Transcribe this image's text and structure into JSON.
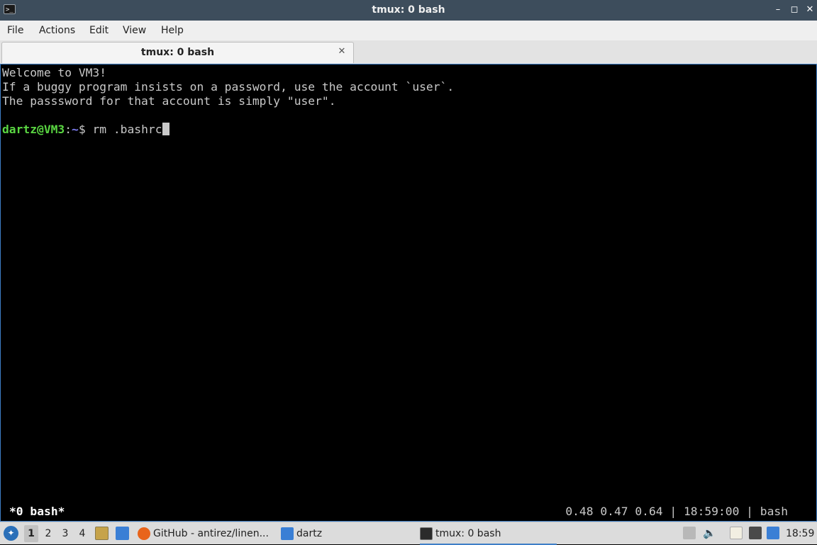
{
  "window": {
    "title": "tmux: 0 bash",
    "controls": {
      "minimize": "–",
      "maximize": "◻",
      "close": "✕"
    }
  },
  "menu": {
    "items": [
      "File",
      "Actions",
      "Edit",
      "View",
      "Help"
    ]
  },
  "tabs": [
    {
      "label": "tmux: 0 bash",
      "close": "✕"
    }
  ],
  "terminal": {
    "lines": [
      "Welcome to VM3!",
      "If a buggy program insists on a password, use the account `user`.",
      "The passsword for that account is simply \"user\"."
    ],
    "prompt": {
      "user_host": "dartz@VM3",
      "separator": ":",
      "path": "~",
      "symbol": "$ ",
      "command": "rm .bashrc"
    },
    "status": {
      "left": "*0 bash*",
      "right": "0.48 0.47 0.64 | 18:59:00 | bash"
    }
  },
  "taskbar": {
    "desktops": [
      "1",
      "2",
      "3",
      "4"
    ],
    "active_desktop": "1",
    "tasks": [
      {
        "label": "GitHub - antirez/linen...",
        "icon": "firefox-icon"
      },
      {
        "label": "dartz",
        "icon": "folder-icon"
      },
      {
        "label": "tmux: 0 bash",
        "icon": "terminal-icon"
      }
    ],
    "clock": "18:59"
  },
  "colors": {
    "titlebar": "#3d4d5c",
    "prompt_user": "#5ad642",
    "prompt_path": "#7c7cf0",
    "focus_border": "#3f7fc7"
  }
}
